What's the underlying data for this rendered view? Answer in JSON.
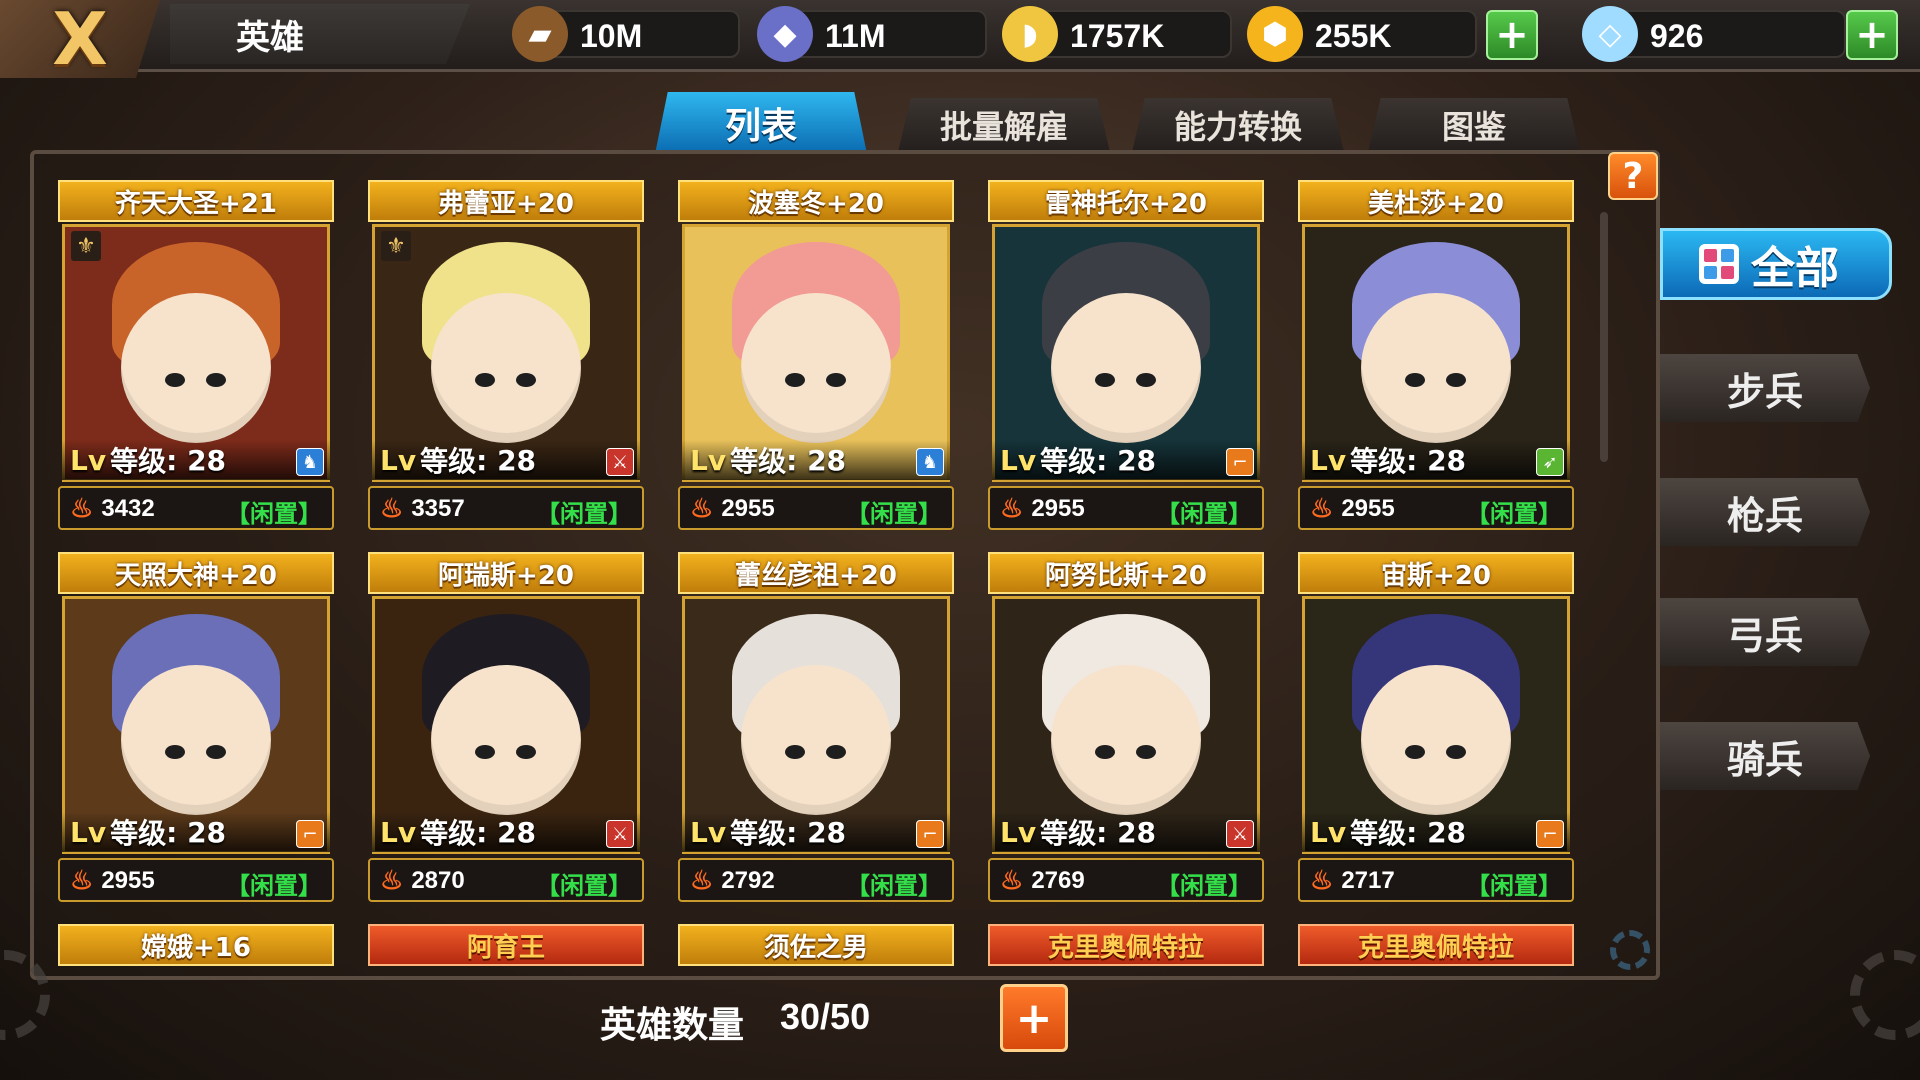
{
  "header": {
    "close_label": "X",
    "title": "英雄",
    "resources": [
      {
        "icon": "wood-icon",
        "value": "10M",
        "color": "#8b5a2b"
      },
      {
        "icon": "crystal-icon",
        "value": "11M",
        "color": "#6a6fc8"
      },
      {
        "icon": "cheese-icon",
        "value": "1757K",
        "color": "#f0c640"
      },
      {
        "icon": "gold-icon",
        "value": "255K",
        "color": "#f5b41c"
      }
    ],
    "diamond": {
      "icon": "diamond-icon",
      "value": "926"
    }
  },
  "tabs": [
    {
      "label": "列表",
      "active": true
    },
    {
      "label": "批量解雇",
      "active": false
    },
    {
      "label": "能力转换",
      "active": false
    },
    {
      "label": "图鉴",
      "active": false
    }
  ],
  "heroes": [
    {
      "name": "齐天大圣+21",
      "level_label": "等级",
      "level": "28",
      "power": "3432",
      "status": "【闲置】",
      "type_icon": "cavalry-icon",
      "type_color": "#2b7fd6",
      "hair": "#c8642a",
      "bg": "#7d2b1a",
      "badge": true
    },
    {
      "name": "弗蕾亚+20",
      "level_label": "等级",
      "level": "28",
      "power": "3357",
      "status": "【闲置】",
      "type_icon": "sword-icon",
      "type_color": "#c9352a",
      "hair": "#f0e28a",
      "bg": "#3a2614",
      "badge": true
    },
    {
      "name": "波塞冬+20",
      "level_label": "等级",
      "level": "28",
      "power": "2955",
      "status": "【闲置】",
      "type_icon": "cavalry-icon",
      "type_color": "#2b7fd6",
      "hair": "#f29a94",
      "bg": "#e8c15a",
      "badge": false
    },
    {
      "name": "雷神托尔+20",
      "level_label": "等级",
      "level": "28",
      "power": "2955",
      "status": "【闲置】",
      "type_icon": "gun-icon",
      "type_color": "#e87a1c",
      "hair": "#3c3e46",
      "bg": "#16343a",
      "badge": false
    },
    {
      "name": "美杜莎+20",
      "level_label": "等级",
      "level": "28",
      "power": "2955",
      "status": "【闲置】",
      "type_icon": "bow-icon",
      "type_color": "#5ab533",
      "hair": "#8b8ed6",
      "bg": "#2a2418",
      "badge": false
    },
    {
      "name": "天照大神+20",
      "level_label": "等级",
      "level": "28",
      "power": "2955",
      "status": "【闲置】",
      "type_icon": "gun-icon",
      "type_color": "#e87a1c",
      "hair": "#6a6fb8",
      "bg": "#5c3a1a",
      "badge": false
    },
    {
      "name": "阿瑞斯+20",
      "level_label": "等级",
      "level": "28",
      "power": "2870",
      "status": "【闲置】",
      "type_icon": "sword-icon",
      "type_color": "#c9352a",
      "hair": "#1e1c22",
      "bg": "#3a2410",
      "badge": false
    },
    {
      "name": "蕾丝彦祖+20",
      "level_label": "等级",
      "level": "28",
      "power": "2792",
      "status": "【闲置】",
      "type_icon": "gun-icon",
      "type_color": "#e87a1c",
      "hair": "#e6e0da",
      "bg": "#3a2a1a",
      "badge": false
    },
    {
      "name": "阿努比斯+20",
      "level_label": "等级",
      "level": "28",
      "power": "2769",
      "status": "【闲置】",
      "type_icon": "sword-icon",
      "type_color": "#c9352a",
      "hair": "#efe9e2",
      "bg": "#2e2418",
      "badge": false
    },
    {
      "name": "宙斯+20",
      "level_label": "等级",
      "level": "28",
      "power": "2717",
      "status": "【闲置】",
      "type_icon": "gun-icon",
      "type_color": "#e87a1c",
      "hair": "#35357a",
      "bg": "#2a2618",
      "badge": false
    }
  ],
  "next_row": [
    {
      "name": "嫦娥+16",
      "color": "gold"
    },
    {
      "name": "阿育王",
      "color": "red"
    },
    {
      "name": "须佐之男",
      "color": "gold"
    },
    {
      "name": "克里奥佩特拉",
      "color": "red"
    },
    {
      "name": "克里奥佩特拉",
      "color": "red"
    }
  ],
  "filters": {
    "all": "全部",
    "items": [
      "步兵",
      "枪兵",
      "弓兵",
      "骑兵"
    ]
  },
  "footer": {
    "count_label": "英雄数量",
    "count_value": "30/50"
  },
  "help_label": "?",
  "plus_label": "+"
}
